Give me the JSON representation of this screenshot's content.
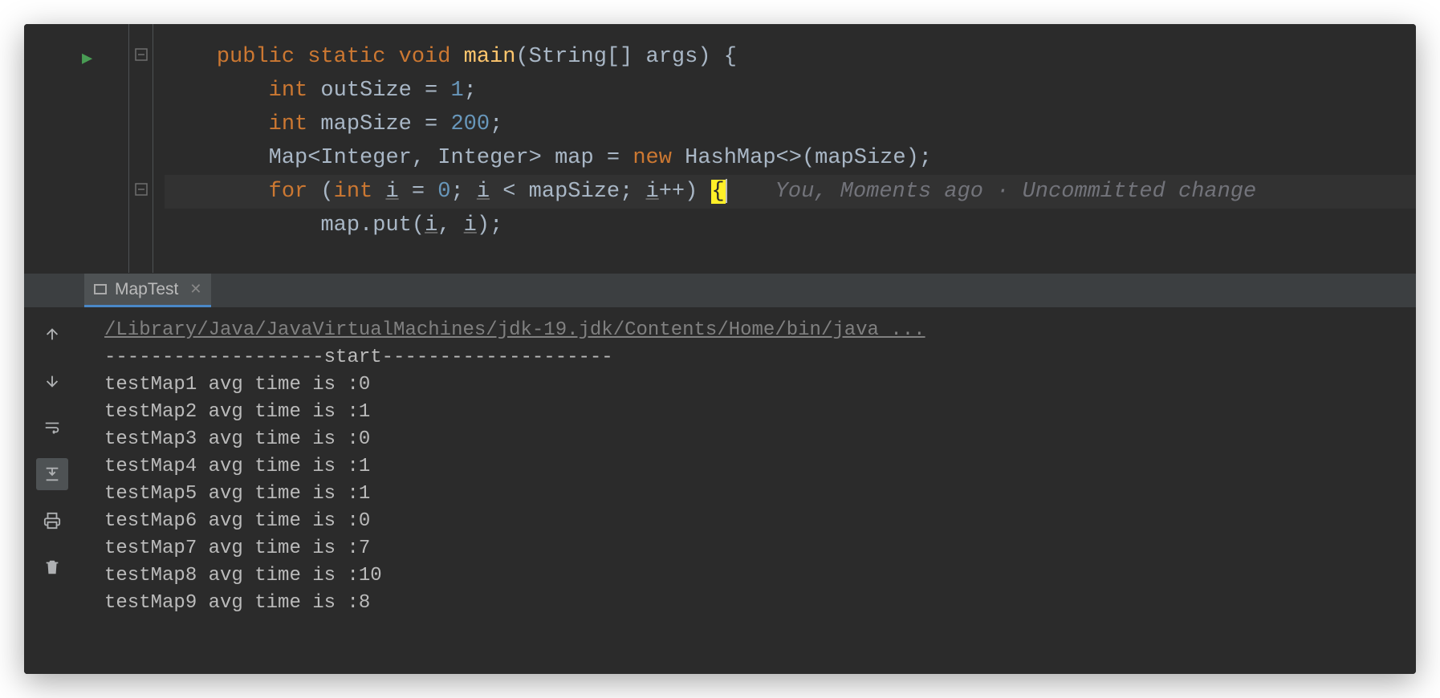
{
  "editor": {
    "inlay_hint": "You, Moments ago · Uncommitted change",
    "code_lines": [
      {
        "indent": "    ",
        "tokens": [
          {
            "t": "public",
            "c": "kw"
          },
          {
            "t": " "
          },
          {
            "t": "static",
            "c": "kw"
          },
          {
            "t": " "
          },
          {
            "t": "void",
            "c": "kw"
          },
          {
            "t": " "
          },
          {
            "t": "main",
            "c": "fn-decl"
          },
          {
            "t": "(String[] args) {",
            "c": "punc"
          }
        ]
      },
      {
        "indent": "        ",
        "tokens": [
          {
            "t": "int",
            "c": "kw"
          },
          {
            "t": " outSize = "
          },
          {
            "t": "1",
            "c": "num"
          },
          {
            "t": ";"
          }
        ]
      },
      {
        "indent": "        ",
        "tokens": [
          {
            "t": "int",
            "c": "kw"
          },
          {
            "t": " mapSize = "
          },
          {
            "t": "200",
            "c": "num"
          },
          {
            "t": ";"
          }
        ]
      },
      {
        "indent": "        ",
        "tokens": [
          {
            "t": "Map<Integer, Integer> map = "
          },
          {
            "t": "new",
            "c": "kw"
          },
          {
            "t": " HashMap<>(mapSize);"
          }
        ]
      },
      {
        "indent": "        ",
        "current": true,
        "tokens": [
          {
            "t": "for",
            "c": "kw"
          },
          {
            "t": " ("
          },
          {
            "t": "int",
            "c": "kw"
          },
          {
            "t": " "
          },
          {
            "t": "i",
            "c": "uvar"
          },
          {
            "t": " = "
          },
          {
            "t": "0",
            "c": "num"
          },
          {
            "t": "; "
          },
          {
            "t": "i",
            "c": "uvar"
          },
          {
            "t": " < mapSize; "
          },
          {
            "t": "i",
            "c": "uvar"
          },
          {
            "t": "++) "
          },
          {
            "t": "{",
            "c": "bracebox"
          }
        ],
        "caret": true,
        "inlay": true
      },
      {
        "indent": "            ",
        "tokens": [
          {
            "t": "map.put("
          },
          {
            "t": "i",
            "c": "uvar"
          },
          {
            "t": ", "
          },
          {
            "t": "i",
            "c": "uvar"
          },
          {
            "t": ");"
          }
        ]
      }
    ]
  },
  "tabbar": {
    "tab_label": "MapTest"
  },
  "console": {
    "header": "/Library/Java/JavaVirtualMachines/jdk-19.jdk/Contents/Home/bin/java ...",
    "divider": "-------------------start--------------------",
    "lines": [
      "testMap1 avg time is :0",
      "testMap2 avg time is :1",
      "testMap3 avg time is :0",
      "testMap4 avg time is :1",
      "testMap5 avg time is :1",
      "testMap6 avg time is :0",
      "testMap7 avg time is :7",
      "testMap8 avg time is :10",
      "testMap9 avg time is :8"
    ]
  }
}
